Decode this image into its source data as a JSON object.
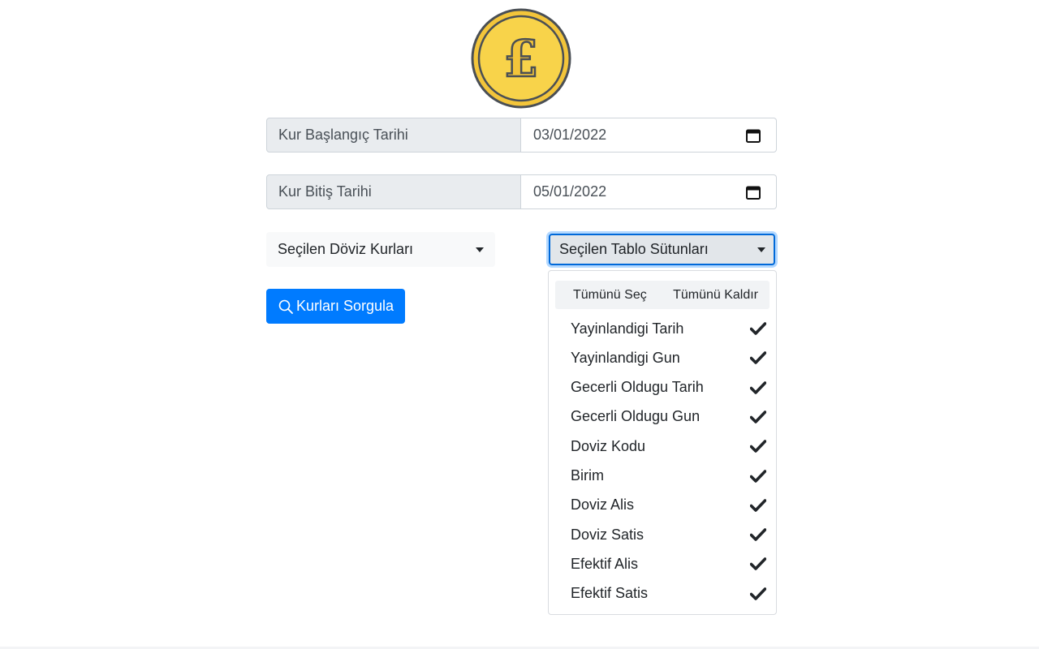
{
  "logo": {
    "icon": "pound-coin-icon",
    "colors": {
      "fill": "#f8d34a",
      "outline": "#4a4f55",
      "rim": "#f3c53a"
    }
  },
  "start_date": {
    "label": "Kur Başlangıç Tarihi",
    "value": "03/01/2022"
  },
  "end_date": {
    "label": "Kur Bitiş Tarihi",
    "value": "05/01/2022"
  },
  "currency_select": {
    "label": "Seçilen Döviz Kurları"
  },
  "columns_select": {
    "label": "Seçilen Tablo Sütunları"
  },
  "search_button": {
    "label": "Kurları Sorgula",
    "color": "#007bff"
  },
  "dropdown": {
    "select_all": "Tümünü Seç",
    "deselect_all": "Tümünü Kaldır",
    "options": [
      {
        "label": "Yayinlandigi Tarih",
        "checked": true
      },
      {
        "label": "Yayinlandigi Gun",
        "checked": true
      },
      {
        "label": "Gecerli Oldugu Tarih",
        "checked": true
      },
      {
        "label": "Gecerli Oldugu Gun",
        "checked": true
      },
      {
        "label": "Doviz Kodu",
        "checked": true
      },
      {
        "label": "Birim",
        "checked": true
      },
      {
        "label": "Doviz Alis",
        "checked": true
      },
      {
        "label": "Doviz Satis",
        "checked": true
      },
      {
        "label": "Efektif Alis",
        "checked": true
      },
      {
        "label": "Efektif Satis",
        "checked": true
      }
    ]
  }
}
